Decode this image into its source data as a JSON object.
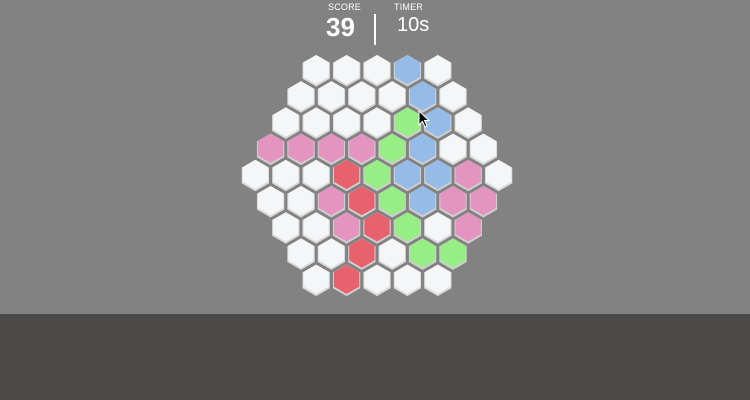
{
  "hud": {
    "score_label": "SCORE",
    "score_value": "39",
    "timer_label": "TIMER",
    "timer_value": "10s"
  },
  "colors": {
    "empty": "#f5f6f7",
    "empty_edge": "#d9dadb",
    "blue": "#95bbe9",
    "green": "#96ee84",
    "pink": "#e394bf",
    "red": "#e8626d",
    "tile_edge": "#d0d0d0",
    "background": "#828282",
    "bottom_band": "#4b4a49"
  },
  "board": {
    "shape": "hexagon",
    "radius": 5,
    "rows": [
      [
        "empty",
        "empty",
        "empty",
        "blue",
        "empty"
      ],
      [
        "empty",
        "empty",
        "empty",
        "empty",
        "blue",
        "empty"
      ],
      [
        "empty",
        "empty",
        "empty",
        "empty",
        "green",
        "blue",
        "empty"
      ],
      [
        "pink",
        "pink",
        "pink",
        "pink",
        "green",
        "blue",
        "empty",
        "empty"
      ],
      [
        "empty",
        "empty",
        "empty",
        "red",
        "green",
        "blue",
        "blue",
        "pink",
        "empty"
      ],
      [
        "empty",
        "empty",
        "pink",
        "red",
        "green",
        "blue",
        "pink",
        "pink"
      ],
      [
        "empty",
        "empty",
        "pink",
        "red",
        "green",
        "empty",
        "pink"
      ],
      [
        "empty",
        "empty",
        "red",
        "empty",
        "green",
        "green"
      ],
      [
        "empty",
        "red",
        "empty",
        "empty",
        "empty"
      ]
    ]
  }
}
